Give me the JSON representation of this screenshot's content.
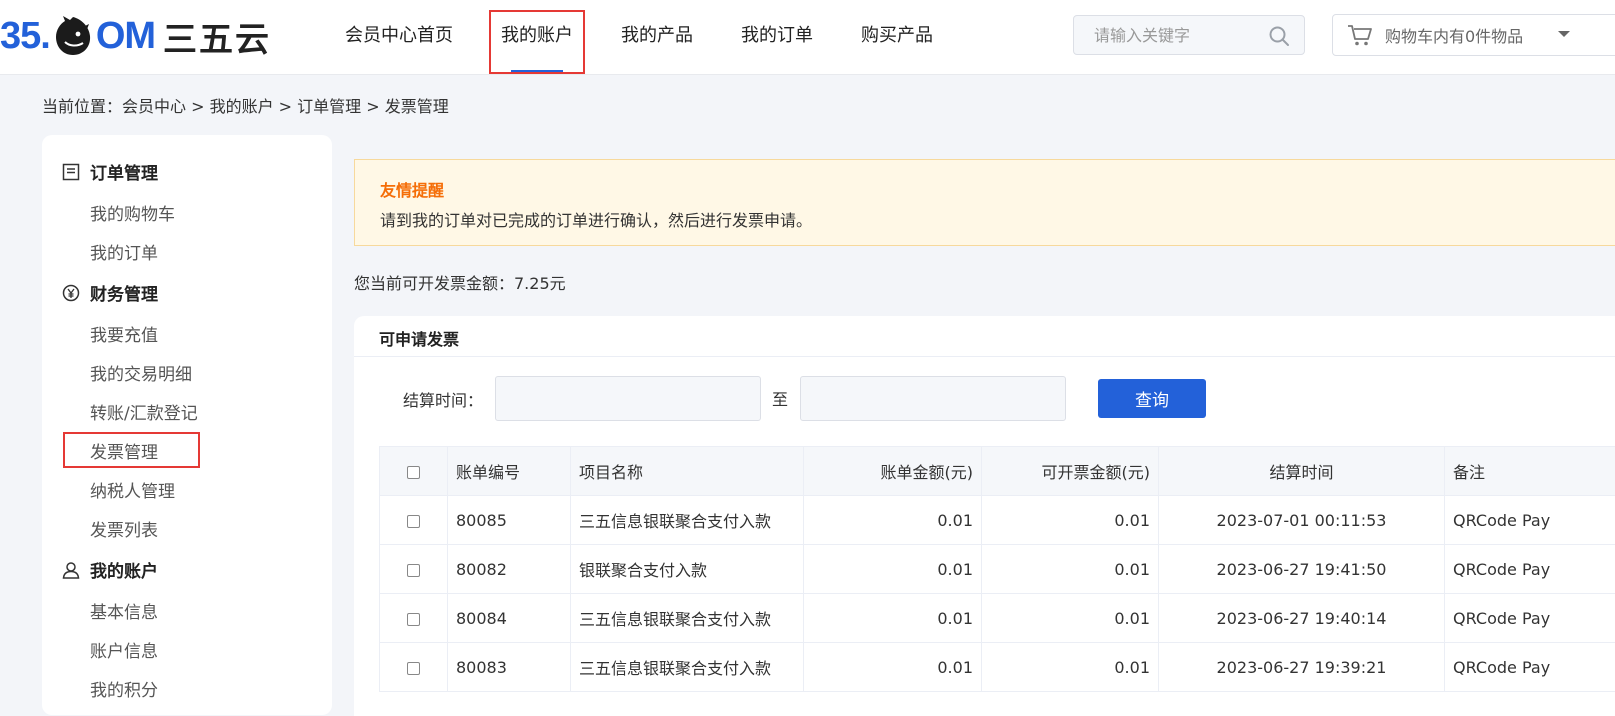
{
  "brand": {
    "logo_num": "35.",
    "logo_om": "OM",
    "logo_cn": "三五云"
  },
  "nav": [
    {
      "label": "会员中心首页"
    },
    {
      "label": "我的账户"
    },
    {
      "label": "我的产品"
    },
    {
      "label": "我的订单"
    },
    {
      "label": "购买产品"
    }
  ],
  "search": {
    "placeholder": "请输入关键字"
  },
  "cart": {
    "label": "购物车内有0件物品"
  },
  "breadcrumb": "当前位置：会员中心 > 我的账户 > 订单管理 > 发票管理",
  "sidebar": {
    "groups": [
      {
        "title": "订单管理",
        "items": [
          "我的购物车",
          "我的订单"
        ]
      },
      {
        "title": "财务管理",
        "items": [
          "我要充值",
          "我的交易明细",
          "转账/汇款登记",
          "发票管理",
          "纳税人管理",
          "发票列表"
        ]
      },
      {
        "title": "我的账户",
        "items": [
          "基本信息",
          "账户信息",
          "我的积分"
        ]
      }
    ]
  },
  "notice": {
    "title": "友情提醒",
    "text": "请到我的订单对已完成的订单进行确认，然后进行发票申请。"
  },
  "amount_text": "您当前可开发票金额：7.25元",
  "panel": {
    "title": "可申请发票",
    "filter_label": "结算时间：",
    "to_label": "至",
    "query_label": "查询"
  },
  "table": {
    "headers": [
      "账单编号",
      "项目名称",
      "账单金额(元)",
      "可开票金额(元)",
      "结算时间",
      "备注"
    ],
    "rows": [
      [
        "80085",
        "三五信息银联聚合支付入款",
        "0.01",
        "0.01",
        "2023-07-01 00:11:53",
        "QRCode Pay"
      ],
      [
        "80082",
        "银联聚合支付入款",
        "0.01",
        "0.01",
        "2023-06-27 19:41:50",
        "QRCode Pay"
      ],
      [
        "80084",
        "三五信息银联聚合支付入款",
        "0.01",
        "0.01",
        "2023-06-27 19:40:14",
        "QRCode Pay"
      ],
      [
        "80083",
        "三五信息银联聚合支付入款",
        "0.01",
        "0.01",
        "2023-06-27 19:39:21",
        "QRCode Pay"
      ]
    ]
  },
  "colors": {
    "brand_blue": "#2361d9",
    "notice_orange": "#f56e08",
    "highlight_red": "#e53935"
  },
  "icons": {
    "search": "search-icon",
    "cart": "cart-icon",
    "order": "list-icon",
    "finance": "yen-icon",
    "account": "user-icon"
  }
}
